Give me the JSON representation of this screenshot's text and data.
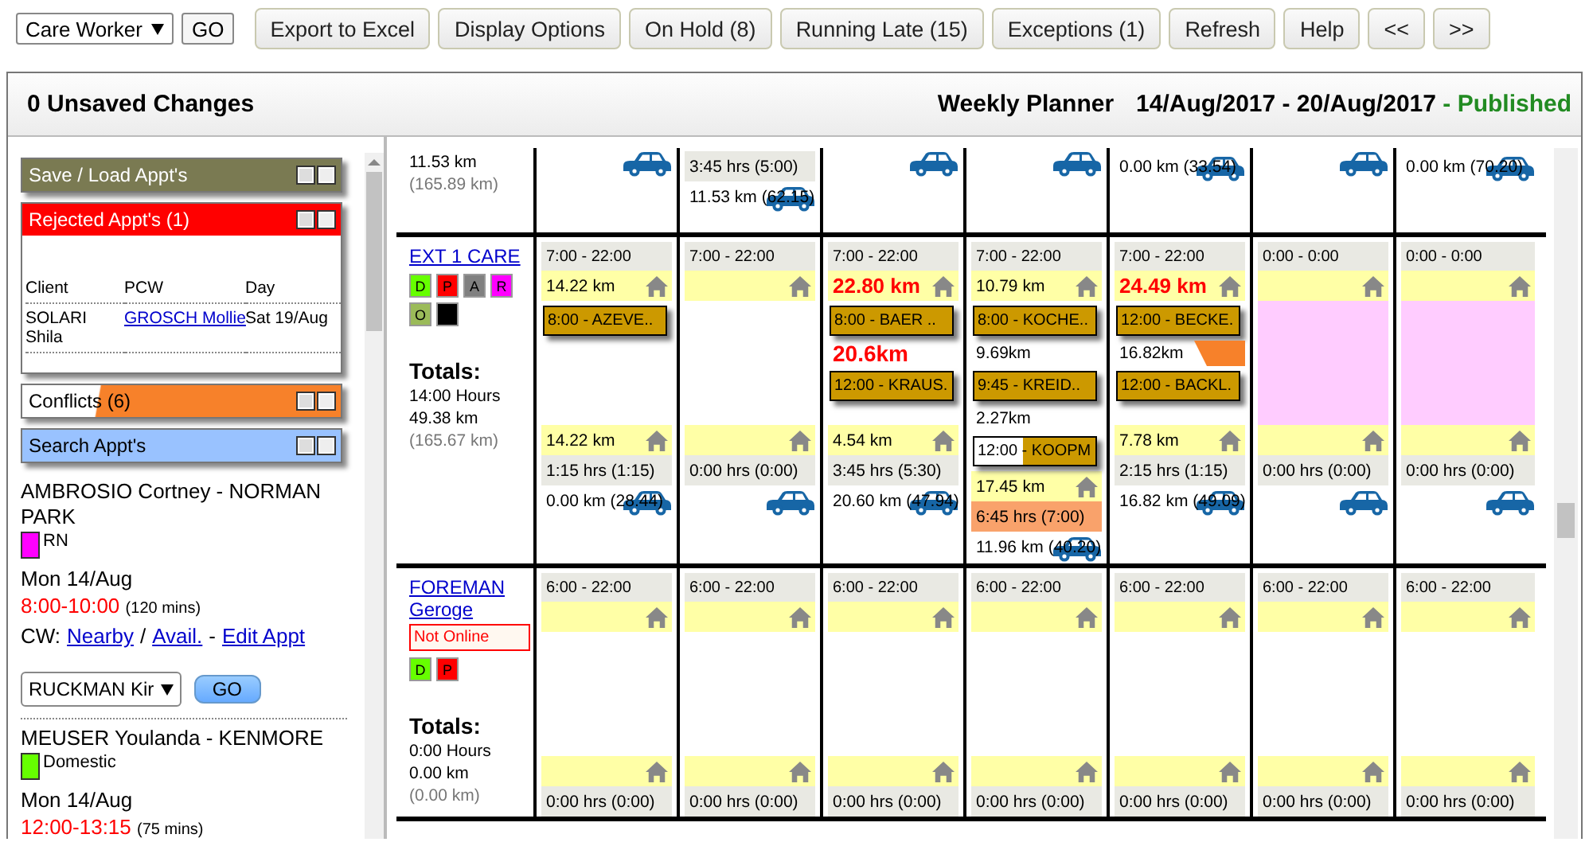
{
  "toolbar": {
    "filter": {
      "value": "Care Worker"
    },
    "go": "GO",
    "buttons": [
      "Export to Excel",
      "Display Options",
      "On Hold (8)",
      "Running Late (15)",
      "Exceptions (1)",
      "Refresh",
      "Help",
      "<<",
      ">>"
    ]
  },
  "header": {
    "unsaved": "0 Unsaved Changes",
    "title": "Weekly Planner",
    "range": "14/Aug/2017 - 20/Aug/2017",
    "status": "- Published"
  },
  "widgets": [
    {
      "kind": "save",
      "title": "Save / Load Appt's"
    },
    {
      "kind": "rejected",
      "title": "Rejected Appt's (1)",
      "columns": [
        "Client",
        "PCW",
        "Day"
      ],
      "rows": [
        {
          "client": "SOLARI Shila",
          "pcw": "GROSCH Mollie",
          "day": "Sat 19/Aug"
        }
      ]
    },
    {
      "kind": "conflicts",
      "title": "Conflicts (6)"
    },
    {
      "kind": "search",
      "title": "Search Appt's"
    }
  ],
  "results": [
    {
      "title": "AMBROSIO Cortney - NORMAN PARK",
      "color": "#ff00ff",
      "service": "RN",
      "date": "Mon 14/Aug",
      "time": "8:00-10:00",
      "duration": "(120 mins)",
      "cw_line": [
        {
          "kind": "text",
          "text": "CW:"
        },
        {
          "kind": "link",
          "text": "Nearby"
        },
        {
          "kind": "text",
          "text": "/"
        },
        {
          "kind": "link",
          "text": "Avail."
        },
        {
          "kind": "text",
          "text": "-"
        },
        {
          "kind": "link",
          "text": "Edit Appt"
        }
      ],
      "worker": "RUCKMAN Kir",
      "go": "GO"
    },
    {
      "title": "MEUSER Youlanda - KENMORE",
      "color": "#66ff00",
      "service": "Domestic",
      "date": "Mon 14/Aug",
      "time": "12:00-13:15",
      "duration": "(75 mins)"
    }
  ],
  "planner": {
    "prev_row": {
      "summary": "11.53 km",
      "total": "(165.89 km)",
      "days": [
        {
          "car": true
        },
        {
          "car": true,
          "duration": "3:45 hrs (5:00)",
          "distance": "11.53 km (62.15)"
        },
        {
          "car": true
        },
        {
          "car": true
        },
        {
          "car": true,
          "distance": "0.00 km (33.54)"
        },
        {
          "car": true
        },
        {
          "car": true,
          "distance": "0.00 km (70.20)"
        }
      ]
    },
    "workers": [
      {
        "name": "EXT 1 CARE",
        "badges": [
          {
            "label": "D",
            "color": "#66ff00"
          },
          {
            "label": "P",
            "color": "#ff0000"
          },
          {
            "label": "A",
            "color": "#808080"
          },
          {
            "label": "R",
            "color": "#ff00ff"
          },
          {
            "label": "O",
            "color": "#9bbb59"
          },
          {
            "color": "#000000"
          }
        ],
        "totals_label": "Totals:",
        "hours": "14:00 Hours",
        "km": "49.38 km",
        "total_km": "(165.67 km)",
        "days": [
          {
            "hours": "7:00 - 22:00",
            "start_km": "14.22 km",
            "start_alert": false,
            "unavailable": false,
            "items": [
              {
                "kind": "appt",
                "label": "8:00 - AZEVE..",
                "partial": false
              }
            ],
            "end_km": "14.22 km",
            "duration": "1:15 hrs (1:15)",
            "over": false,
            "distance": "0.00 km (28.44)",
            "car": true
          },
          {
            "hours": "7:00 - 22:00",
            "unavailable": false,
            "duration": "0:00 hrs (0:00)",
            "over": false,
            "car": true
          },
          {
            "hours": "7:00 - 22:00",
            "start_km": "22.80 km",
            "start_alert": true,
            "unavailable": false,
            "items": [
              {
                "kind": "appt",
                "label": "8:00 - BAER ..",
                "partial": false
              },
              {
                "kind": "travel",
                "text": "20.6km",
                "alert": true,
                "conflict": false
              },
              {
                "kind": "appt",
                "label": "12:00 - KRAUS.",
                "partial": false
              }
            ],
            "end_km": "4.54 km",
            "duration": "3:45 hrs (5:30)",
            "over": false,
            "distance": "20.60 km (47.94)",
            "car": true
          },
          {
            "hours": "7:00 - 22:00",
            "start_km": "10.79 km",
            "start_alert": false,
            "unavailable": false,
            "items": [
              {
                "kind": "appt",
                "label": "8:00 - KOCHE..",
                "partial": false
              },
              {
                "kind": "travel",
                "text": "9.69km",
                "alert": false,
                "conflict": false
              },
              {
                "kind": "appt",
                "label": "9:45 - KREID..",
                "partial": false
              },
              {
                "kind": "travel",
                "text": "2.27km",
                "alert": false,
                "conflict": false
              },
              {
                "kind": "appt",
                "label": "12:00 - KOOPM",
                "partial": true
              }
            ],
            "end_km": "17.45 km",
            "duration": "6:45 hrs (7:00)",
            "over": true,
            "distance": "11.96 km (40.20)",
            "car": true
          },
          {
            "hours": "7:00 - 22:00",
            "start_km": "24.49 km",
            "start_alert": true,
            "unavailable": false,
            "items": [
              {
                "kind": "appt",
                "label": "12:00 - BECKE.",
                "partial": false
              },
              {
                "kind": "travel",
                "text": "16.82km",
                "alert": false,
                "conflict": true
              },
              {
                "kind": "appt",
                "label": "12:00 - BACKL.",
                "partial": false
              }
            ],
            "end_km": "7.78 km",
            "duration": "2:15 hrs (1:15)",
            "over": false,
            "distance": "16.82 km (49.09)",
            "car": true
          },
          {
            "hours": "0:00 - 0:00",
            "unavailable": true,
            "duration": "0:00 hrs (0:00)",
            "over": false,
            "car": true
          },
          {
            "hours": "0:00 - 0:00",
            "unavailable": true,
            "duration": "0:00 hrs (0:00)",
            "over": false,
            "car": true
          }
        ]
      },
      {
        "name": "FOREMAN Geroge",
        "status": "Not Online",
        "badges": [
          {
            "label": "D",
            "color": "#66ff00"
          },
          {
            "label": "P",
            "color": "#ff0000"
          }
        ],
        "totals_label": "Totals:",
        "hours": "0:00 Hours",
        "km": "0.00 km",
        "total_km": "(0.00 km)",
        "days": [
          {
            "hours": "6:00 - 22:00",
            "unavailable": false,
            "duration": "0:00 hrs (0:00)",
            "over": false,
            "car": false
          },
          {
            "hours": "6:00 - 22:00",
            "unavailable": false,
            "duration": "0:00 hrs (0:00)",
            "over": false,
            "car": false
          },
          {
            "hours": "6:00 - 22:00",
            "unavailable": false,
            "duration": "0:00 hrs (0:00)",
            "over": false,
            "car": false
          },
          {
            "hours": "6:00 - 22:00",
            "unavailable": false,
            "duration": "0:00 hrs (0:00)",
            "over": false,
            "car": false
          },
          {
            "hours": "6:00 - 22:00",
            "unavailable": false,
            "duration": "0:00 hrs (0:00)",
            "over": false,
            "car": false
          },
          {
            "hours": "6:00 - 22:00",
            "unavailable": false,
            "duration": "0:00 hrs (0:00)",
            "over": false,
            "car": false
          },
          {
            "hours": "6:00 - 22:00",
            "unavailable": false,
            "duration": "0:00 hrs (0:00)",
            "over": false,
            "car": false
          }
        ]
      }
    ]
  }
}
